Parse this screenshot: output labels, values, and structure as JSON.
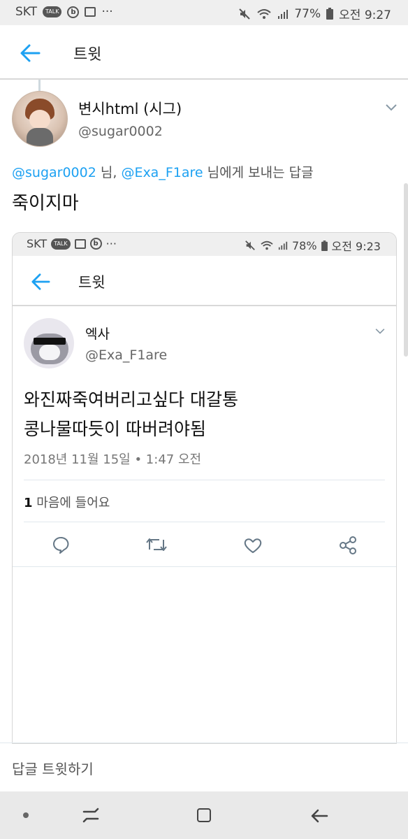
{
  "status_bar": {
    "carrier": "SKT",
    "talk_badge": "TALK",
    "more": "···",
    "battery_percent": "77%",
    "time": "오전 9:27"
  },
  "app_bar": {
    "title": "트윗"
  },
  "reply_tweet": {
    "display_name": "변시html (시그)",
    "handle": "@sugar0002",
    "reply_to": {
      "mention1": "@sugar0002",
      "sep1": "님,",
      "mention2": "@Exa_F1are",
      "rest": "님에게 보내는 답글"
    },
    "text": "죽이지마"
  },
  "embedded": {
    "status_bar": {
      "carrier": "SKT",
      "more": "···",
      "battery_percent": "78%",
      "time": "오전 9:23"
    },
    "app_bar": {
      "title": "트윗"
    },
    "tweet": {
      "display_name": "엑사",
      "handle": "@Exa_F1are",
      "text_line1": "와진짜죽여버리고싶다 대갈통",
      "text_line2": "콩나물따듯이 따버려야됨",
      "timestamp": "2018년 11월 15일 • 1:47 오전",
      "likes_count": "1",
      "likes_label": "마음에 들어요"
    }
  },
  "reply_bar": {
    "placeholder": "답글 트윗하기"
  },
  "colors": {
    "accent": "#1da1f2"
  }
}
